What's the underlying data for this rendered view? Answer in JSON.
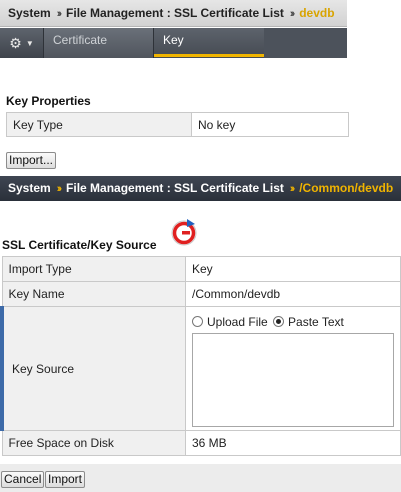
{
  "header1": {
    "crumbs": [
      "System",
      "File Management : SSL Certificate List"
    ],
    "separator": "››",
    "leaf": "devdb"
  },
  "tabs": {
    "gear_icon": "gear-icon",
    "items": [
      {
        "label": "Certificate",
        "active": false
      },
      {
        "label": "Key",
        "active": true
      }
    ]
  },
  "key_properties": {
    "title": "Key Properties",
    "rows": [
      {
        "label": "Key Type",
        "value": "No key"
      }
    ],
    "import_button": "Import..."
  },
  "header2": {
    "crumbs": [
      "System",
      "File Management : SSL Certificate List"
    ],
    "separator": "››",
    "leaf": "/Common/devdb"
  },
  "source": {
    "title": "SSL Certificate/Key Source",
    "import_type": {
      "label": "Import Type",
      "value": "Key"
    },
    "key_name": {
      "label": "Key Name",
      "value": "/Common/devdb"
    },
    "key_source": {
      "label": "Key Source",
      "options": [
        {
          "label": "Upload File",
          "selected": false
        },
        {
          "label": "Paste Text",
          "selected": true
        }
      ],
      "text_value": ""
    },
    "free_space": {
      "label": "Free Space on Disk",
      "value": "36 MB"
    }
  },
  "actions": {
    "cancel": "Cancel",
    "import": "Import"
  },
  "colors": {
    "accent": "#f0b400",
    "dark_bar": "#2f3540",
    "logo_red": "#e02020"
  }
}
